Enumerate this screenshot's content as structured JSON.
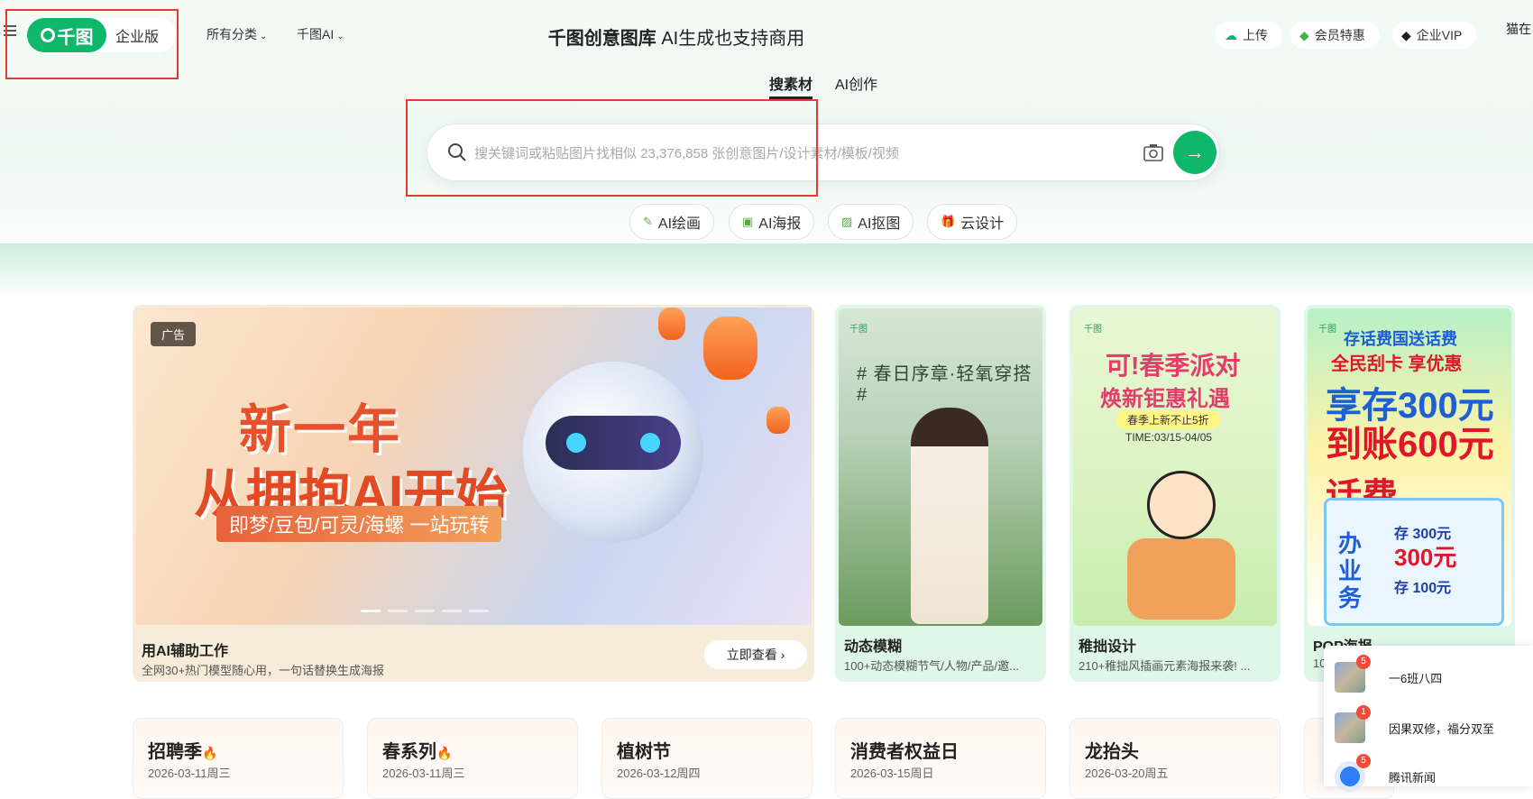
{
  "header": {
    "logo_text": "千图",
    "enterprise_label": "企业版",
    "nav": [
      {
        "label": "所有分类"
      },
      {
        "label": "千图AI"
      }
    ],
    "title_bold": "千图创意图库",
    "title_rest": "AI生成也支持商用",
    "upload_label": "上传",
    "member_label": "会员特惠",
    "vip_label": "企业VIP",
    "user_label": "猫在"
  },
  "tabs": [
    {
      "label": "搜素材",
      "active": true
    },
    {
      "label": "AI创作",
      "active": false
    }
  ],
  "search": {
    "placeholder": "搜关键词或粘贴图片找相似 23,376,858 张创意图片/设计素材/模板/视频",
    "go_glyph": "→"
  },
  "quick_links": [
    {
      "label": "AI绘画",
      "icon": "brush-icon",
      "glyph": "✎"
    },
    {
      "label": "AI海报",
      "icon": "poster-icon",
      "glyph": "▣"
    },
    {
      "label": "AI抠图",
      "icon": "cutout-icon",
      "glyph": "▨"
    },
    {
      "label": "云设计",
      "icon": "gift-icon",
      "glyph": "🎁"
    }
  ],
  "banner": {
    "ad_badge": "广告",
    "headline_1": "新一年",
    "headline_2": "从拥抱AI开始",
    "tagline": "即梦/豆包/可灵/海螺 一站玩转",
    "caption_title": "用AI辅助工作",
    "caption_sub": "全网30+热门模型随心用，一句话替换生成海报",
    "view_button": "立即查看"
  },
  "cards": [
    {
      "title": "动态模糊",
      "subtitle": "100+动态模糊节气/人物/产品/邀...",
      "poster_logo": "千图",
      "poster_text": "# 春日序章·轻氧穿搭 #"
    },
    {
      "title": "稚拙设计",
      "subtitle": "210+稚拙风插画元素海报来袭! ...",
      "poster_logo": "千图",
      "poster_text_1": "可!春季派对",
      "poster_text_2": "焕新钜惠礼遇",
      "poster_text_3": "春季上新不止5折",
      "poster_text_4": "TIME:03/15-04/05"
    },
    {
      "title": "POP海报",
      "subtitle": "10",
      "poster_logo": "千图",
      "poster_text_1": "存话费国送话费",
      "poster_text_2": "全民刮卡 享优惠",
      "poster_text_3": "享存300元",
      "poster_text_4": "到账600元话费",
      "panel_vert": "办业务",
      "panel_a": "存 300元",
      "panel_b": "300元",
      "panel_c": "存 100元"
    }
  ],
  "festivals": [
    {
      "name": "招聘季",
      "hot": "🔥",
      "date": "2026-03-11周三"
    },
    {
      "name": "春系列",
      "hot": "🔥",
      "date": "2026-03-11周三"
    },
    {
      "name": "植树节",
      "hot": "",
      "date": "2026-03-12周四"
    },
    {
      "name": "消费者权益日",
      "hot": "",
      "date": "2026-03-15周日"
    },
    {
      "name": "龙抬头",
      "hot": "",
      "date": "2026-03-20周五"
    }
  ],
  "notifications": [
    {
      "badge": "5",
      "text": "一6班八四"
    },
    {
      "badge": "1",
      "text": "因果双修，福分双至"
    },
    {
      "badge": "5",
      "text": "腾讯新闻"
    }
  ],
  "colors": {
    "brand": "#0fb76b",
    "highlight": "#e53935"
  }
}
